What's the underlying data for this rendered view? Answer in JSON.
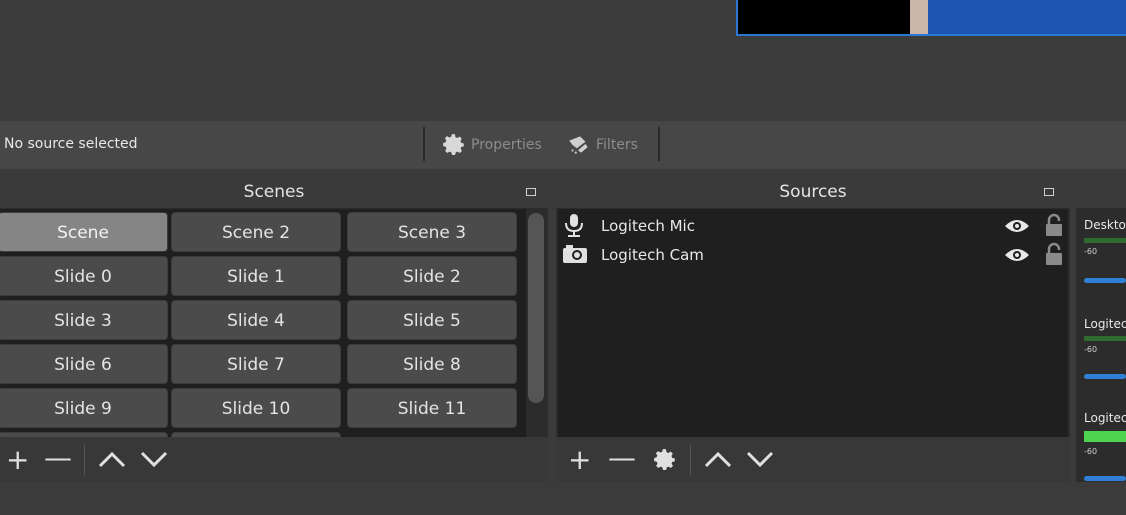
{
  "context_bar": {
    "status": "No source selected",
    "properties_label": "Properties",
    "filters_label": "Filters"
  },
  "scenes": {
    "title": "Scenes",
    "items": [
      "Scene",
      "Scene 2",
      "Scene 3",
      "Slide 0",
      "Slide 1",
      "Slide 2",
      "Slide 3",
      "Slide 4",
      "Slide 5",
      "Slide 6",
      "Slide 7",
      "Slide 8",
      "Slide 9",
      "Slide 10",
      "Slide 11"
    ],
    "selected": "Scene",
    "toolbar": {
      "add": "+",
      "remove": "—",
      "up": "⌃",
      "down": "⌄"
    }
  },
  "sources": {
    "title": "Sources",
    "items": [
      {
        "name": "Logitech Mic",
        "icon": "microphone-icon"
      },
      {
        "name": "Logitech Cam",
        "icon": "camera-icon"
      }
    ]
  },
  "mixer": {
    "channels": [
      {
        "label": "Deskto",
        "tick": "-60"
      },
      {
        "label": "Logitec",
        "tick": "-60"
      },
      {
        "label": "Logitec",
        "tick": "-60"
      }
    ]
  },
  "colors": {
    "accent": "#2b78d2",
    "meter_green": "#4fd44f",
    "slider_blue": "#2f80d6"
  }
}
